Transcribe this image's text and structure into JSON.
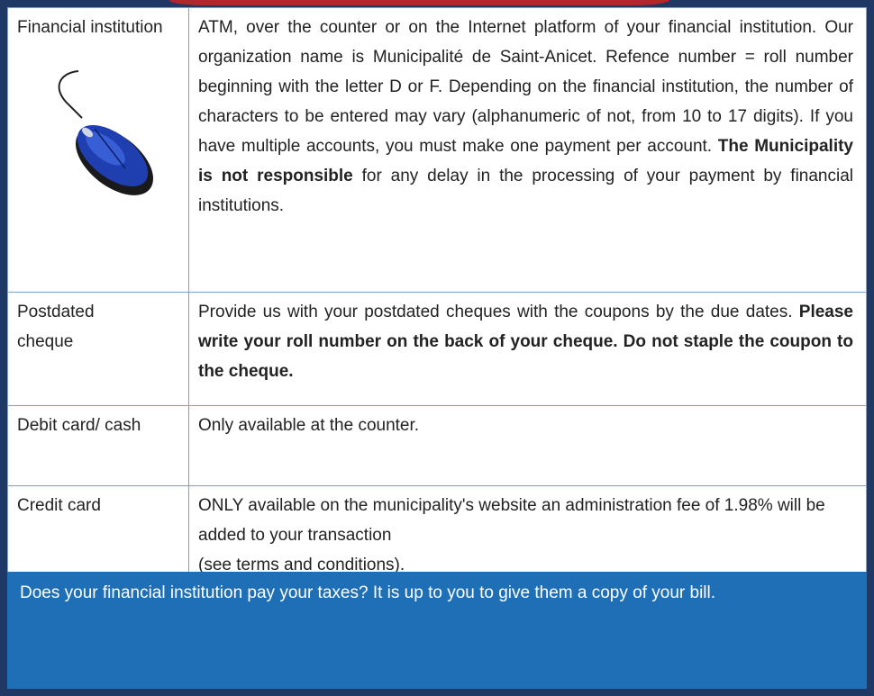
{
  "rows": [
    {
      "method": "Financial institution",
      "text1": "ATM, over the counter or on the Internet platform of your financial institution. Our organization name is Municipalité de Saint-Anicet. Refence number = roll number beginning with the letter D or F. Depending on the financial institution, the number of characters to be entered may vary (alphanumeric of not, from 10 to 17 digits). If you have multiple accounts, you must make one payment per account.",
      "bold": "The Municipality is not responsible",
      "text2": "for any delay in the processing of your payment by financial institutions."
    },
    {
      "method": "Postdated cheque",
      "text1": "Provide us with your postdated cheques with the coupons by the due dates.",
      "bold": "Please write your roll number on the back of your cheque. Do not staple the coupon to the cheque."
    },
    {
      "method": "Debit card/ cash",
      "text1": "Only available at the counter."
    },
    {
      "method": "Credit card",
      "line1": "ONLY available on the municipality's website an administration fee of 1.98% will be added to your transaction",
      "line2": "(see terms and conditions)."
    }
  ],
  "footer": "Does your financial institution pay your taxes? It is up to you to give them a copy of your bill.",
  "colors": {
    "frame": "#1f3864",
    "footer_bg": "#1e6fb6",
    "warning_text": "#c00000",
    "top_banner": "#b3262a"
  },
  "icons": [
    "computer-mouse-icon"
  ]
}
